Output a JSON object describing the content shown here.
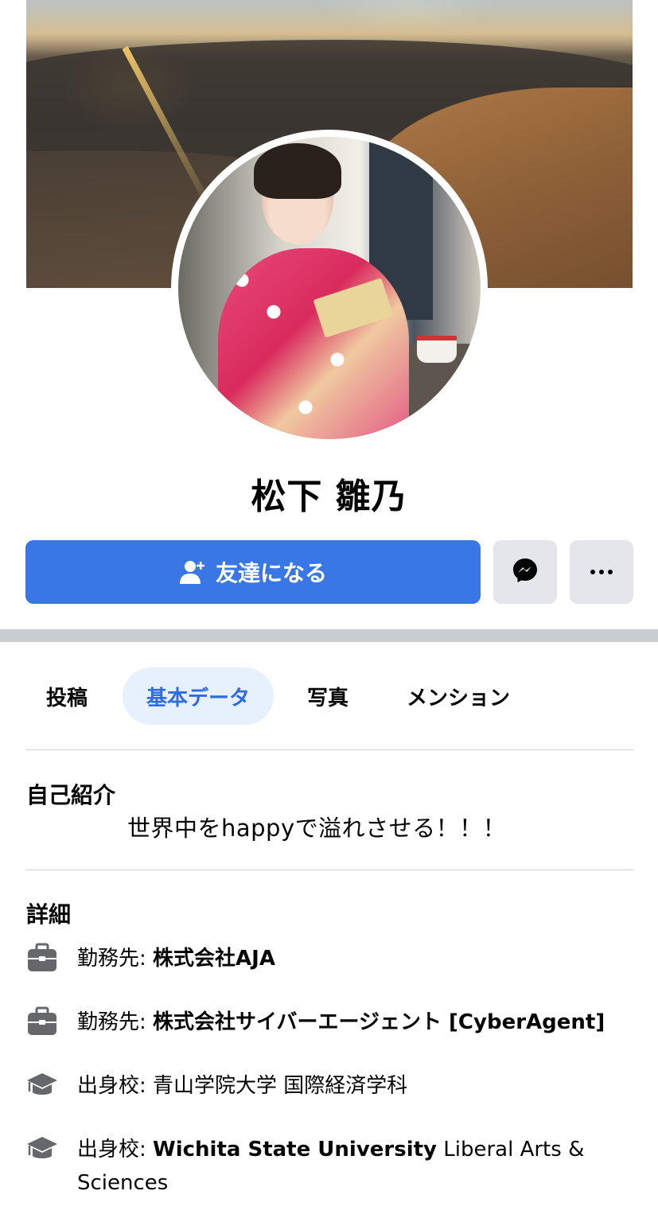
{
  "profile": {
    "name": "松下 雛乃"
  },
  "actions": {
    "add_friend_label": "友達になる"
  },
  "tabs": [
    {
      "label": "投稿"
    },
    {
      "label": "基本データ"
    },
    {
      "label": "写真"
    },
    {
      "label": "メンション"
    }
  ],
  "intro": {
    "title": "自己紹介",
    "bio": "世界中をhappyで溢れさせる！！！"
  },
  "details": {
    "title": "詳細",
    "items": [
      {
        "prefix": "勤務先: ",
        "value": "株式会社AJA",
        "suffix": "",
        "icon": "briefcase-icon"
      },
      {
        "prefix": "勤務先: ",
        "value": "株式会社サイバーエージェント [CyberAgent]",
        "suffix": "",
        "icon": "briefcase-icon"
      },
      {
        "prefix": "出身校: ",
        "value": "",
        "suffix": "青山学院大学 国際経済学科",
        "icon": "graduation-cap-icon"
      },
      {
        "prefix": "出身校: ",
        "value": "Wichita State University",
        "suffix": " Liberal Arts & Sciences",
        "icon": "graduation-cap-icon"
      }
    ]
  },
  "colors": {
    "primary": "#3a77e6",
    "tab_active_bg": "#e7f0fd",
    "tab_active_text": "#2f6ce0",
    "button_gray": "#e4e6eb",
    "separator": "#c9ccd1"
  }
}
